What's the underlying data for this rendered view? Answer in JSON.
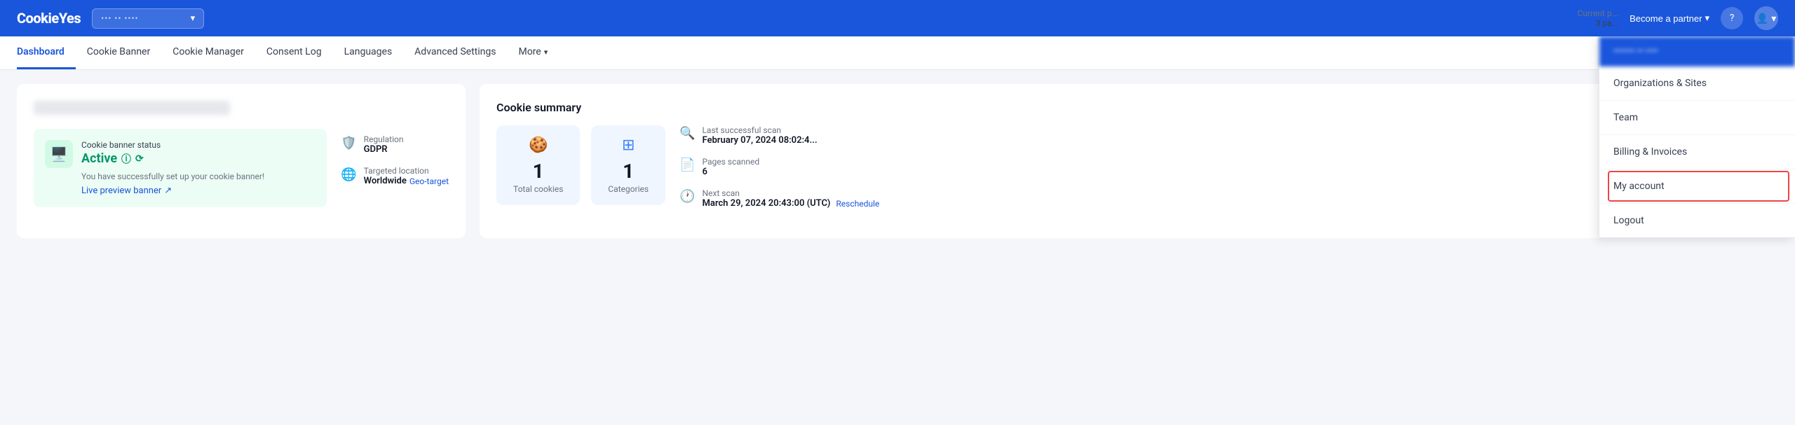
{
  "topbar": {
    "logo_text": "CookieYes",
    "site_selector_placeholder": "••• •• ••••",
    "become_partner_label": "Become a partner",
    "current_plan_label": "Current p...",
    "current_plan_value": "3 pa..."
  },
  "nav": {
    "items": [
      {
        "label": "Dashboard",
        "active": true
      },
      {
        "label": "Cookie Banner",
        "active": false
      },
      {
        "label": "Cookie Manager",
        "active": false
      },
      {
        "label": "Consent Log",
        "active": false
      },
      {
        "label": "Languages",
        "active": false
      },
      {
        "label": "Advanced Settings",
        "active": false
      },
      {
        "label": "More",
        "active": false,
        "has_arrow": true
      }
    ]
  },
  "left_panel": {
    "blurred_title": "••• ••• •••••••••••• •••",
    "status_card": {
      "label": "Cookie banner status",
      "status": "Active",
      "description": "You have successfully set up your cookie banner!",
      "live_preview": "Live preview banner"
    },
    "regulation": {
      "label": "Regulation",
      "value": "GDPR"
    },
    "targeted_location": {
      "label": "Targeted location",
      "value": "Worldwide",
      "geo_link": "Geo-target"
    }
  },
  "right_panel": {
    "title": "Cookie summary",
    "cards": [
      {
        "icon": "🍪",
        "number": "1",
        "label": "Total cookies"
      },
      {
        "icon": "⊞",
        "number": "1",
        "label": "Categories"
      }
    ],
    "scan_info": [
      {
        "label": "Last successful scan",
        "value": "February 07, 2024 08:02:4..."
      },
      {
        "label": "Pages scanned",
        "value": "6"
      },
      {
        "label": "Next scan",
        "value": "March 29, 2024 20:43:00 (UTC)",
        "has_reschedule": true,
        "reschedule_label": "Reschedule"
      }
    ]
  },
  "dropdown": {
    "header_blurred": "••••••• •• ••••",
    "items": [
      {
        "label": "Organizations & Sites",
        "highlighted": false
      },
      {
        "label": "Team",
        "highlighted": false
      },
      {
        "label": "Billing & Invoices",
        "highlighted": false
      },
      {
        "label": "My account",
        "highlighted": true
      },
      {
        "label": "Logout",
        "highlighted": false,
        "is_logout": true
      }
    ]
  }
}
